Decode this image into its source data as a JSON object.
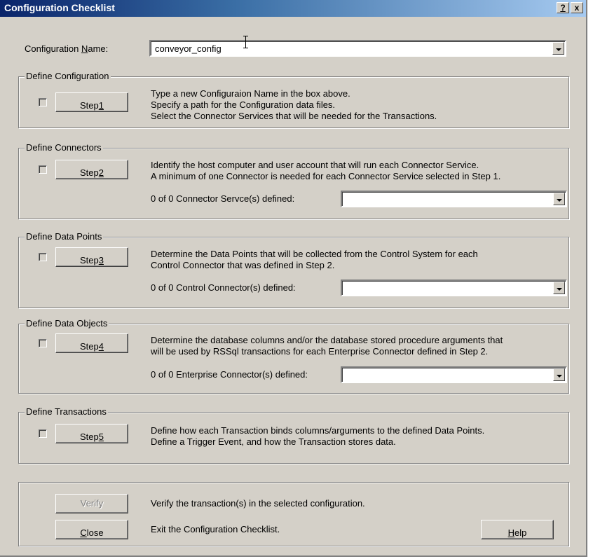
{
  "window": {
    "title": "Configuration Checklist",
    "help_glyph": "?",
    "close_glyph": "x"
  },
  "config_name": {
    "label_prefix": "Configuration ",
    "label_accel": "N",
    "label_suffix": "ame:",
    "value": "conveyor_config"
  },
  "steps": [
    {
      "group": "Define Configuration",
      "button_prefix": "Step ",
      "button_accel": "1",
      "lines": [
        "Type a new Configuraion Name in the box above.",
        "Specify a path for the Configuration data files.",
        "Select the Connector Services that will be needed for the Transactions."
      ],
      "checked": false
    },
    {
      "group": "Define Connectors",
      "button_prefix": "Step ",
      "button_accel": "2",
      "lines": [
        "Identify the host computer and user account that will run each Connector Service.",
        "A minimum of one Connector is needed for each Connector Service selected in Step 1."
      ],
      "count_label": "0 of 0 Connector Servce(s) defined:",
      "combo_value": "",
      "checked": false
    },
    {
      "group": "Define Data Points",
      "button_prefix": "Step ",
      "button_accel": "3",
      "lines": [
        "Determine the Data Points that will be collected from the Control System for each",
        "Control Connector that was defined in Step 2."
      ],
      "count_label": "0 of 0 Control Connector(s) defined:",
      "combo_value": "",
      "checked": false
    },
    {
      "group": "Define Data Objects",
      "button_prefix": "Step ",
      "button_accel": "4",
      "lines": [
        "Determine the database columns and/or the database stored procedure arguments that",
        "will be used by RSSql transactions for each Enterprise Connector defined in Step 2."
      ],
      "count_label": "0 of 0 Enterprise Connector(s) defined:",
      "combo_value": "",
      "checked": false
    },
    {
      "group": "Define Transactions",
      "button_prefix": "Step ",
      "button_accel": "5",
      "lines": [
        "Define how each Transaction binds columns/arguments to the defined Data Points.",
        "Define a Trigger Event, and how the Transaction stores data."
      ],
      "checked": false
    }
  ],
  "bottom": {
    "verify_label": "Verify",
    "verify_desc": "Verify the transaction(s) in the selected configuration.",
    "close_accel": "C",
    "close_rest": "lose",
    "close_desc": "Exit the Configuration Checklist.",
    "help_accel": "H",
    "help_rest": "elp"
  }
}
